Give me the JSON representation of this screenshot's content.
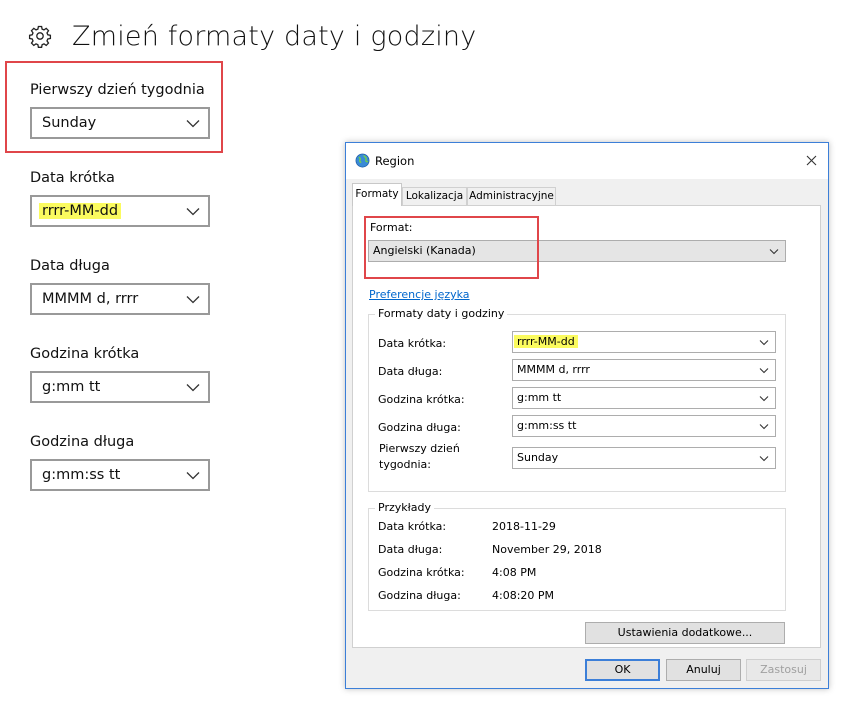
{
  "settings": {
    "title": "Zmień formaty daty i godziny",
    "fields": [
      {
        "label": "Pierwszy dzień tygodnia",
        "value": "Sunday"
      },
      {
        "label": "Data krótka",
        "value": "rrrr-MM-dd"
      },
      {
        "label": "Data długa",
        "value": "MMMM d, rrrr"
      },
      {
        "label": "Godzina krótka",
        "value": "g:mm tt"
      },
      {
        "label": "Godzina długa",
        "value": "g:mm:ss tt"
      }
    ]
  },
  "dialog": {
    "title": "Region",
    "tabs": [
      "Formaty",
      "Lokalizacja",
      "Administracyjne"
    ],
    "format_label": "Format:",
    "format_value": "Angielski (Kanada)",
    "language_link": "Preferencje języka",
    "formats_group": {
      "legend": "Formaty daty i godziny",
      "rows": [
        {
          "label": "Data krótka:",
          "value": "rrrr-MM-dd"
        },
        {
          "label": "Data długa:",
          "value": "MMMM d, rrrr"
        },
        {
          "label": "Godzina krótka:",
          "value": "g:mm tt"
        },
        {
          "label": "Godzina długa:",
          "value": "g:mm:ss tt"
        },
        {
          "label_line1": "Pierwszy dzień",
          "label_line2": "tygodnia:",
          "value": "Sunday"
        }
      ]
    },
    "examples_group": {
      "legend": "Przykłady",
      "rows": [
        {
          "label": "Data krótka:",
          "value": "2018-11-29"
        },
        {
          "label": "Data długa:",
          "value": "November 29, 2018"
        },
        {
          "label": "Godzina krótka:",
          "value": "4:08 PM"
        },
        {
          "label": "Godzina długa:",
          "value": "4:08:20 PM"
        }
      ]
    },
    "additional_button": "Ustawienia dodatkowe...",
    "ok_button": "OK",
    "cancel_button": "Anuluj",
    "apply_button": "Zastosuj"
  },
  "colors": {
    "highlight": "#fbfb5f",
    "red_outline": "#e0464a",
    "dialog_border": "#3c7fd8",
    "link": "#0066cc"
  }
}
